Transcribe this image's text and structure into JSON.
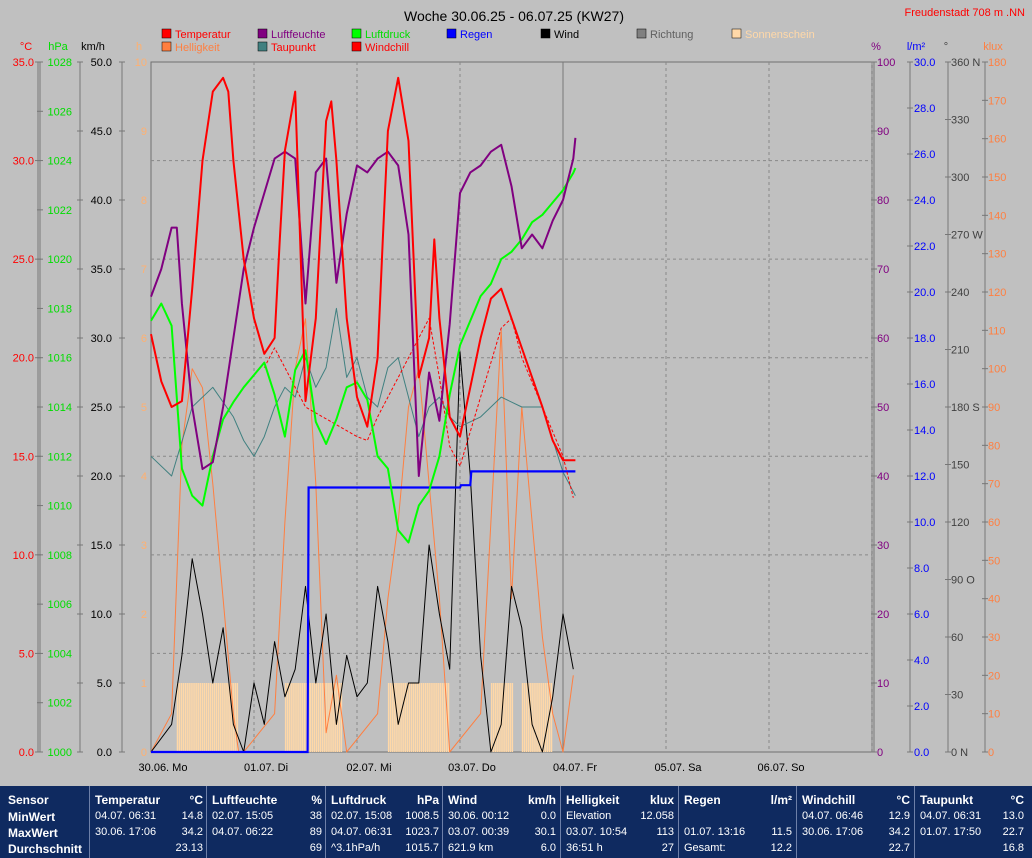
{
  "title": "Woche 30.06.25 - 06.07.25 (KW27)",
  "location": "Freudenstadt 708 m  .NN",
  "colors": {
    "background": "#c0c0c0",
    "temperature": "#ff0000",
    "humidity": "#800080",
    "pressure": "#00ff00",
    "rain": "#0000ff",
    "wind": "#000000",
    "brightness": "#ff7f40",
    "dewpoint": "#408080",
    "windchill": "#ff0000",
    "sunshine": "#ffd8a8",
    "direction": "#808080"
  },
  "legend": [
    {
      "label": "Temperatur",
      "color": "#ff0000",
      "text_color": "#ff0000"
    },
    {
      "label": "Helligkeit",
      "color": "#ff7f40",
      "text_color": "#ff7f40"
    },
    {
      "label": "Luftfeuchte",
      "color": "#800080",
      "text_color": "#800080"
    },
    {
      "label": "Taupunkt",
      "color": "#408080",
      "text_color": "#ff0000"
    },
    {
      "label": "Luftdruck",
      "color": "#00ff00",
      "text_color": "#00dd00"
    },
    {
      "label": "Windchill",
      "color": "#ff0000",
      "text_color": "#ff0000"
    },
    {
      "label": "Regen",
      "color": "#0000ff",
      "text_color": "#0000ff"
    },
    {
      "label": "Wind",
      "color": "#000000",
      "text_color": "#000000"
    },
    {
      "label": "Richtung",
      "color": "#808080",
      "text_color": "#606060"
    },
    {
      "label": "Sonnenschein",
      "color": "#ffd8a8",
      "text_color": "#ffd8a8"
    }
  ],
  "axes": {
    "temp": {
      "unit": "°C",
      "ticks": [
        "35.0",
        "30.0",
        "25.0",
        "20.0",
        "15.0",
        "10.0",
        "5.0",
        "0.0"
      ],
      "color": "#ff0000",
      "min": 0,
      "max": 35
    },
    "pressure": {
      "unit": "hPa",
      "ticks": [
        "1028",
        "1026",
        "1024",
        "1022",
        "1020",
        "1018",
        "1016",
        "1014",
        "1012",
        "1010",
        "1008",
        "1006",
        "1004",
        "1002",
        "1000"
      ],
      "color": "#00dd00",
      "min": 1000,
      "max": 1028
    },
    "wind": {
      "unit": "km/h",
      "ticks": [
        "50.0",
        "45.0",
        "40.0",
        "35.0",
        "30.0",
        "25.0",
        "20.0",
        "15.0",
        "10.0",
        "5.0",
        "0.0"
      ],
      "color": "#000000",
      "min": 0,
      "max": 50
    },
    "sun": {
      "unit": "h",
      "ticks": [
        "10",
        "9",
        "8",
        "7",
        "6",
        "5",
        "4",
        "3",
        "2",
        "1",
        "0"
      ],
      "color": "#ffb070",
      "min": 0,
      "max": 10
    },
    "hum": {
      "unit": "%",
      "ticks": [
        "100",
        "90",
        "80",
        "70",
        "60",
        "50",
        "40",
        "30",
        "20",
        "10",
        "0"
      ],
      "color": "#800080",
      "min": 0,
      "max": 100
    },
    "rain": {
      "unit": "l/m²",
      "ticks": [
        "30.0",
        "28.0",
        "26.0",
        "24.0",
        "22.0",
        "20.0",
        "18.0",
        "16.0",
        "14.0",
        "12.0",
        "10.0",
        "8.0",
        "6.0",
        "4.0",
        "2.0",
        "0.0"
      ],
      "color": "#0000ff",
      "min": 0,
      "max": 30
    },
    "dir": {
      "unit": "°",
      "ticks": [
        "360 N",
        "330",
        "300",
        "270 W",
        "240",
        "210",
        "180 S",
        "150",
        "120",
        "90  O",
        "60",
        "30",
        "0   N"
      ],
      "color": "#404040",
      "min": 0,
      "max": 360
    },
    "lux": {
      "unit": "klux",
      "ticks": [
        "180",
        "170",
        "160",
        "150",
        "140",
        "130",
        "120",
        "110",
        "100",
        "90",
        "80",
        "70",
        "60",
        "50",
        "40",
        "30",
        "20",
        "10",
        "0"
      ],
      "color": "#ff7f40",
      "min": 0,
      "max": 180
    }
  },
  "days": [
    "30.06. Mo",
    "01.07. Di",
    "02.07. Mi",
    "03.07. Do",
    "04.07. Fr",
    "05.07. Sa",
    "06.07. So"
  ],
  "chart_data": {
    "type": "line",
    "title": "Woche 30.06.25 - 06.07.25 (KW27)",
    "x_unit": "days since 30.06. 00:00",
    "x_range": [
      0,
      7
    ],
    "series": [
      {
        "name": "Temperatur",
        "axis": "temp",
        "color": "#ff0000",
        "x": [
          0,
          0.1,
          0.2,
          0.3,
          0.4,
          0.5,
          0.6,
          0.7,
          0.75,
          0.8,
          0.9,
          1.0,
          1.1,
          1.2,
          1.25,
          1.3,
          1.4,
          1.5,
          1.6,
          1.7,
          1.75,
          1.8,
          1.9,
          2.0,
          2.1,
          2.2,
          2.25,
          2.3,
          2.4,
          2.5,
          2.6,
          2.7,
          2.75,
          2.8,
          2.9,
          3.0,
          3.1,
          3.2,
          3.3,
          3.4,
          3.5,
          3.6,
          3.7,
          3.8,
          3.9,
          4.0,
          4.1,
          4.12
        ],
        "y": [
          21.2,
          18.8,
          17.5,
          17.8,
          23.5,
          30.0,
          33.5,
          34.2,
          33.5,
          30.0,
          25.0,
          22.0,
          20.2,
          21.0,
          26.0,
          30.5,
          33.5,
          17.8,
          22.0,
          32.0,
          33.0,
          30.0,
          22.0,
          18.0,
          16.5,
          20.0,
          26.0,
          31.5,
          34.2,
          31.0,
          19.0,
          21.0,
          26.0,
          22.0,
          17.0,
          16.0,
          18.5,
          21.0,
          23.0,
          23.5,
          22.0,
          20.5,
          19.0,
          17.5,
          15.8,
          14.8,
          14.8,
          14.8
        ]
      },
      {
        "name": "Windchill",
        "axis": "temp",
        "color": "#ff0000",
        "dashed": true,
        "x": [
          1.1,
          1.2,
          1.5,
          2.0,
          2.1,
          2.2,
          2.7,
          2.8,
          2.9,
          3.0,
          3.4,
          3.5,
          3.6,
          4.0,
          4.1
        ],
        "y": [
          19.5,
          20.5,
          17.5,
          16.0,
          15.8,
          17.0,
          22.0,
          19.0,
          15.5,
          14.5,
          21.5,
          22.0,
          20.0,
          15.0,
          12.9
        ]
      },
      {
        "name": "Luftfeuchte",
        "axis": "hum",
        "color": "#800080",
        "x": [
          0,
          0.1,
          0.2,
          0.25,
          0.3,
          0.4,
          0.5,
          0.6,
          0.7,
          0.8,
          0.9,
          1.0,
          1.1,
          1.2,
          1.3,
          1.4,
          1.5,
          1.6,
          1.7,
          1.8,
          1.9,
          2.0,
          2.1,
          2.2,
          2.3,
          2.4,
          2.5,
          2.6,
          2.7,
          2.8,
          2.9,
          3.0,
          3.1,
          3.2,
          3.3,
          3.4,
          3.5,
          3.6,
          3.7,
          3.8,
          3.9,
          4.0,
          4.1,
          4.12
        ],
        "y": [
          66,
          70,
          76,
          76,
          65,
          50,
          41,
          42,
          50,
          60,
          70,
          76,
          81,
          86,
          87,
          86,
          65,
          84,
          86,
          68,
          78,
          85,
          84,
          86,
          87,
          85,
          75,
          40,
          55,
          48,
          62,
          81,
          84,
          85,
          87,
          88,
          82,
          73,
          75,
          73,
          77,
          80,
          86,
          89
        ]
      },
      {
        "name": "Luftdruck",
        "axis": "pressure",
        "color": "#00ff00",
        "x": [
          0,
          0.1,
          0.2,
          0.3,
          0.4,
          0.5,
          0.6,
          0.7,
          0.8,
          0.9,
          1.0,
          1.1,
          1.2,
          1.3,
          1.4,
          1.5,
          1.6,
          1.7,
          1.8,
          1.9,
          2.0,
          2.1,
          2.2,
          2.3,
          2.4,
          2.5,
          2.6,
          2.7,
          2.8,
          2.9,
          3.0,
          3.1,
          3.2,
          3.3,
          3.4,
          3.5,
          3.6,
          3.7,
          3.8,
          3.9,
          4.0,
          4.1,
          4.12
        ],
        "y": [
          1017.5,
          1018.2,
          1017.3,
          1011.5,
          1010.4,
          1010.0,
          1012.0,
          1013.5,
          1014.2,
          1014.8,
          1015.3,
          1015.8,
          1014.5,
          1012.8,
          1015.5,
          1016.3,
          1013.4,
          1012.5,
          1013.5,
          1014.8,
          1015.0,
          1014.3,
          1012.0,
          1011.5,
          1009.0,
          1008.5,
          1010.0,
          1010.6,
          1012.0,
          1014.5,
          1016.5,
          1017.5,
          1018.5,
          1019.0,
          1020.0,
          1020.3,
          1020.8,
          1021.5,
          1021.8,
          1022.3,
          1022.8,
          1023.5,
          1023.7
        ]
      },
      {
        "name": "Taupunkt",
        "axis": "temp",
        "color": "#408080",
        "x": [
          0,
          0.2,
          0.4,
          0.6,
          0.8,
          0.9,
          1.0,
          1.1,
          1.2,
          1.3,
          1.4,
          1.5,
          1.6,
          1.7,
          1.8,
          1.9,
          2.0,
          2.1,
          2.2,
          2.3,
          2.4,
          2.5,
          2.6,
          2.7,
          2.8,
          2.9,
          3.0,
          3.2,
          3.4,
          3.6,
          3.8,
          4.0,
          4.12
        ],
        "y": [
          15.0,
          14.0,
          17.5,
          18.5,
          17.0,
          15.8,
          15.0,
          16.0,
          17.5,
          18.5,
          18.0,
          20.0,
          18.5,
          19.5,
          22.5,
          19.0,
          20.0,
          18.0,
          17.5,
          19.5,
          20.0,
          18.0,
          16.0,
          17.5,
          18.0,
          17.0,
          16.5,
          17.0,
          18.0,
          17.5,
          17.5,
          14.2,
          13.0
        ]
      },
      {
        "name": "Wind",
        "axis": "wind",
        "color": "#000000",
        "x": [
          0,
          0.2,
          0.3,
          0.4,
          0.5,
          0.6,
          0.7,
          0.8,
          0.9,
          1.0,
          1.1,
          1.2,
          1.3,
          1.4,
          1.5,
          1.6,
          1.7,
          1.8,
          1.9,
          2.0,
          2.1,
          2.2,
          2.3,
          2.4,
          2.5,
          2.6,
          2.7,
          2.8,
          2.9,
          3.0,
          3.1,
          3.2,
          3.3,
          3.4,
          3.5,
          3.6,
          3.7,
          3.8,
          3.9,
          4.0,
          4.1
        ],
        "y": [
          0,
          2,
          7,
          14,
          10,
          5,
          9,
          2,
          0,
          5,
          2,
          8,
          4,
          6,
          12,
          5,
          10,
          2,
          7,
          4,
          5,
          12,
          8,
          2,
          5,
          5,
          15,
          10,
          6,
          29,
          20,
          7,
          0,
          2,
          12,
          9,
          2,
          0,
          4,
          10,
          6
        ]
      },
      {
        "name": "Helligkeit",
        "axis": "lux",
        "color": "#ff7f40",
        "x": [
          0,
          0.2,
          0.3,
          0.4,
          0.5,
          0.6,
          0.7,
          0.8,
          0.85,
          0.9,
          1.2,
          1.3,
          1.4,
          1.5,
          1.6,
          1.7,
          1.8,
          1.9,
          2.2,
          2.3,
          2.4,
          2.5,
          2.6,
          2.7,
          2.8,
          2.9,
          3.2,
          3.3,
          3.4,
          3.5,
          3.6,
          3.7,
          3.8,
          3.9,
          4.0,
          4.1
        ],
        "y": [
          0,
          10,
          80,
          100,
          95,
          70,
          40,
          10,
          0,
          0,
          10,
          60,
          100,
          113,
          70,
          5,
          20,
          0,
          10,
          40,
          60,
          90,
          100,
          70,
          40,
          0,
          10,
          60,
          110,
          40,
          90,
          60,
          30,
          10,
          0,
          20
        ]
      },
      {
        "name": "Regen",
        "axis": "rain",
        "color": "#0000ff",
        "step": true,
        "x": [
          0,
          1.52,
          1.53,
          3.0,
          3.01,
          3.1,
          3.11,
          4.12
        ],
        "y": [
          0,
          0,
          11.5,
          11.5,
          11.6,
          11.6,
          12.2,
          12.2
        ]
      },
      {
        "name": "Sonnenschein",
        "axis": "sun",
        "color": "#ffd8a8",
        "bars": true,
        "x_ranges": [
          [
            0.25,
            0.85
          ],
          [
            1.3,
            1.85
          ],
          [
            2.3,
            2.9
          ],
          [
            3.3,
            3.5
          ],
          [
            3.6,
            3.9
          ]
        ],
        "y": 1
      }
    ]
  },
  "stats": {
    "labels": {
      "header": "Sensor",
      "min": "MinWert",
      "max": "MaxWert",
      "avg": "Durchschnitt"
    },
    "blocks": [
      {
        "name": "Temperatur",
        "unit": "°C",
        "rows": [
          [
            "04.07.  06:31",
            "14.8"
          ],
          [
            "30.06.  17:06",
            "34.2"
          ],
          [
            "",
            "23.13"
          ]
        ]
      },
      {
        "name": "Luftfeuchte",
        "unit": "%",
        "rows": [
          [
            "02.07.  15:05",
            "38"
          ],
          [
            "04.07.  06:22",
            "89"
          ],
          [
            "",
            "69"
          ]
        ]
      },
      {
        "name": "Luftdruck",
        "unit": "hPa",
        "rows": [
          [
            "02.07.  15:08",
            "1008.5"
          ],
          [
            "04.07.  06:31",
            "1023.7"
          ],
          [
            "^3.1hPa/h",
            "1015.7"
          ]
        ]
      },
      {
        "name": "Wind",
        "unit": "km/h",
        "rows": [
          [
            "30.06.  00:12",
            "0.0"
          ],
          [
            "03.07.  00:39",
            "30.1"
          ],
          [
            "621.9 km",
            "6.0"
          ]
        ]
      },
      {
        "name": "Helligkeit",
        "unit": "klux",
        "rows": [
          [
            "Elevation",
            "12.058"
          ],
          [
            "03.07.  10:54",
            "113"
          ],
          [
            "36:51 h",
            "27"
          ]
        ]
      },
      {
        "name": "Regen",
        "unit": "l/m²",
        "rows": [
          [
            "",
            ""
          ],
          [
            "01.07.  13:16",
            "11.5"
          ],
          [
            "Gesamt:",
            "12.2"
          ]
        ]
      },
      {
        "name": "Windchill",
        "unit": "°C",
        "rows": [
          [
            "04.07.  06:46",
            "12.9"
          ],
          [
            "30.06.  17:06",
            "34.2"
          ],
          [
            "",
            "22.7"
          ]
        ]
      },
      {
        "name": "Taupunkt",
        "unit": "°C",
        "rows": [
          [
            "04.07.  06:31",
            "13.0"
          ],
          [
            "01.07.  17:50",
            "22.7"
          ],
          [
            "",
            "16.8"
          ]
        ]
      }
    ]
  }
}
